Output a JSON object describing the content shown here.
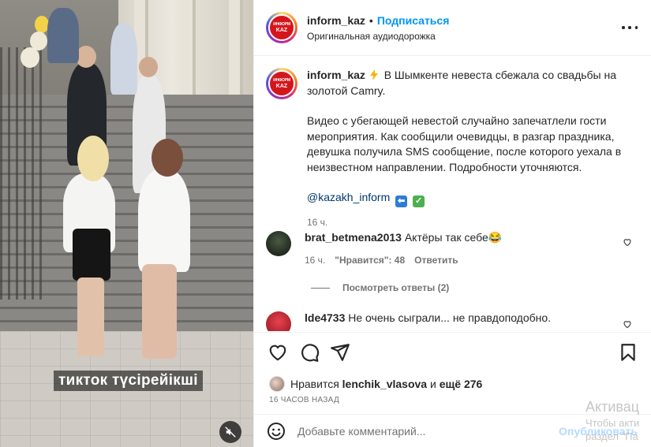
{
  "post": {
    "username": "inform_kaz",
    "follow_label": "Подписаться",
    "dot": "•",
    "audio_label": "Оригинальная аудиодорожка",
    "avatar_text_top": "ИНФОРМ",
    "avatar_text_bottom": "KAZ"
  },
  "video": {
    "overlay_caption": "тикток түсірейікші",
    "muted": true
  },
  "caption": {
    "username": "inform_kaz",
    "line1": "В Шымкенте невеста сбежала со свадьбы на золотой Camry.",
    "paragraph": "Видео с убегающей невестой случайно запечатлели гости мероприятия. Как сообщили очевидцы, в разгар праздника, девушка получила SMS сообщение, после которого уехала в неизвестном направлении. Подробности уточняются.",
    "hashtag": "@kazakh_inform",
    "time": "16 ч."
  },
  "comments": [
    {
      "username": "brat_betmena2013",
      "text": "Актёры так себе😂",
      "time": "16 ч.",
      "likes": "\"Нравится\": 48",
      "reply_label": "Ответить"
    },
    {
      "username": "lde4733",
      "text": "Не очень сыграли... не правдоподобно."
    }
  ],
  "view_replies": "Посмотреть ответы (2)",
  "likes": {
    "prefix": "Нравится",
    "user": "lenchik_vlasova",
    "middle": "и",
    "rest": "ещё 276"
  },
  "timestamp": "16 ЧАСОВ НАЗАД",
  "add_comment": {
    "placeholder": "Добавьте комментарий...",
    "publish_label": "Опубликовать"
  },
  "watermark": {
    "line1": "Активац",
    "line2": "Чтобы акти",
    "line3": "раздел \"Па"
  },
  "colors": {
    "follow": "#0095f6",
    "publish_disabled": "#b3dbff",
    "text": "#262626",
    "secondary": "#737373",
    "avatar_bg": "#d4161c"
  }
}
